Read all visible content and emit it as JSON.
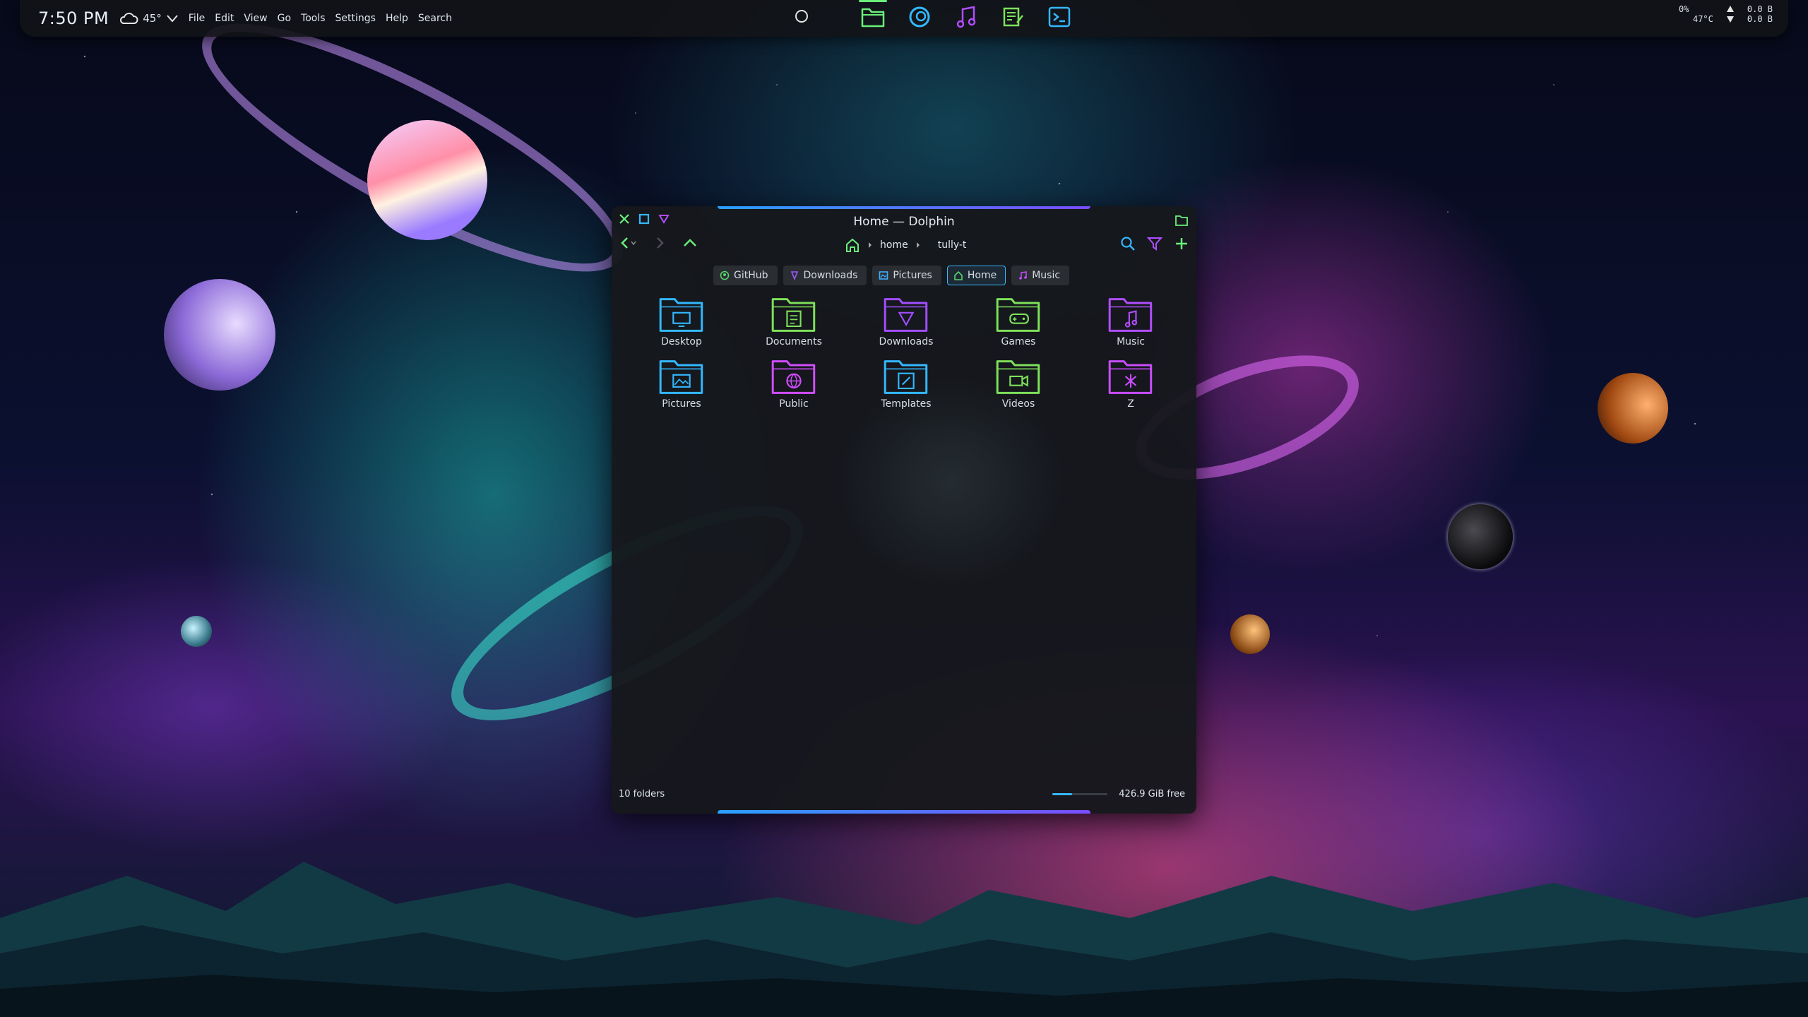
{
  "panel": {
    "clock": "7:50 PM",
    "weather_temp": "45°",
    "menu": [
      "File",
      "Edit",
      "View",
      "Go",
      "Tools",
      "Settings",
      "Help",
      "Search"
    ],
    "dock": [
      "file-manager",
      "browser",
      "music-player",
      "text-editor",
      "terminal"
    ],
    "cpu_percent": "0%",
    "cpu_temp": "47°C",
    "net_up": "0.0 B",
    "net_down": "0.0 B"
  },
  "window": {
    "title": "Home — Dolphin",
    "breadcrumb": [
      "home",
      "tully-t"
    ],
    "places": [
      {
        "label": "GitHub",
        "icon": "github-icon",
        "color": "#55d46a"
      },
      {
        "label": "Downloads",
        "icon": "download-icon",
        "color": "#9b59ff"
      },
      {
        "label": "Pictures",
        "icon": "picture-icon",
        "color": "#3fb0ff"
      },
      {
        "label": "Home",
        "icon": "home-icon",
        "color": "#55d46a"
      },
      {
        "label": "Music",
        "icon": "music-icon",
        "color": "#c64dff"
      }
    ],
    "folders": [
      {
        "label": "Desktop",
        "color": "#33b8ff"
      },
      {
        "label": "Documents",
        "color": "#7ee05a"
      },
      {
        "label": "Downloads",
        "color": "#a24dff"
      },
      {
        "label": "Games",
        "color": "#7ee05a"
      },
      {
        "label": "Music",
        "color": "#b04dff"
      },
      {
        "label": "Pictures",
        "color": "#33b8ff"
      },
      {
        "label": "Public",
        "color": "#d04dff"
      },
      {
        "label": "Templates",
        "color": "#33b8ff"
      },
      {
        "label": "Videos",
        "color": "#7ee05a"
      },
      {
        "label": "Z",
        "color": "#c84dff"
      }
    ],
    "status": "10 folders",
    "free_space": "426.9 GiB free",
    "disk_used_fraction": 0.35
  },
  "colors": {
    "accent_blue": "#35b8ff",
    "accent_purple": "#7a4dff",
    "accent_green": "#6af07a"
  }
}
